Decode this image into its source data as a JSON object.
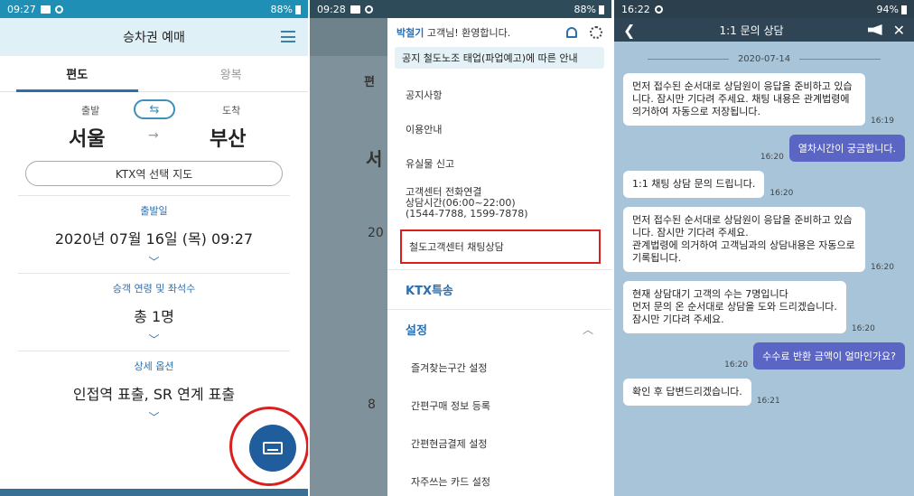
{
  "screen1": {
    "status": {
      "time": "09:27",
      "right": "88%"
    },
    "title": "승차권 예매",
    "tabs": [
      "편도",
      "왕복"
    ],
    "route": {
      "from_label": "출발",
      "to_label": "도착",
      "from_city": "서울",
      "to_city": "부산",
      "arrow": "→"
    },
    "map_button": "KTX역 선택 지도",
    "departure": {
      "label": "출발일",
      "value": "2020년 07월 16일 (목) 09:27"
    },
    "passengers": {
      "label": "승객 연령 및 좌석수",
      "value": "총 1명"
    },
    "options": {
      "label": "상세 옵션",
      "value": "인접역 표출, SR 연계 표출"
    },
    "chevron": "﹀"
  },
  "screen2": {
    "status": {
      "time": "09:28",
      "right": "88%"
    },
    "ghost": {
      "tab": "편",
      "city": "서",
      "date": "20",
      "num": "8"
    },
    "greeting_name": "박철기",
    "greeting_rest": " 고객님! 환영합니다.",
    "notice": "공지 철도노조 태업(파업예고)에 따른 안내",
    "menu": [
      "공지사항",
      "이용안내",
      "유실물 신고"
    ],
    "callcenter": [
      "고객센터 전화연결",
      "상담시간(06:00~22:00)",
      "(1544-7788, 1599-7878)"
    ],
    "chat_item": "철도고객센터 채팅상담",
    "section_ktx": "KTX특송",
    "section_settings": "설정",
    "settings_items": [
      "즐겨찾는구간 설정",
      "간편구매 정보 등록",
      "간편현금결제 설정",
      "자주쓰는 카드 설정"
    ]
  },
  "screen3": {
    "status": {
      "time": "16:22",
      "right": "94%"
    },
    "title": "1:1 문의 상담",
    "date": "2020-07-14",
    "messages": [
      {
        "dir": "in",
        "text": "먼저 접수된 순서대로 상담원이 응답을 준비하고 있습니다. 잠시만 기다려 주세요. 채팅 내용은 관계법령에 의거하여 자동으로 저장됩니다.",
        "time": "16:19"
      },
      {
        "dir": "out",
        "text": "열차시간이 궁금합니다.",
        "time": "16:20"
      },
      {
        "dir": "in",
        "text": "1:1 채팅 상담 문의 드립니다.",
        "time": "16:20"
      },
      {
        "dir": "in",
        "text": "먼저 접수된 순서대로 상담원이 응답을 준비하고 있습니다. 잠시만 기다려 주세요.\n관계법령에 의거하여 고객님과의 상담내용은 자동으로 기록됩니다.",
        "time": "16:20"
      },
      {
        "dir": "in",
        "text": "현재 상담대기 고객의 수는 7명입니다\n먼저 문의 온 순서대로 상담을 도와 드리겠습니다.\n잠시만 기다려 주세요.",
        "time": "16:20"
      },
      {
        "dir": "out",
        "text": "수수료 반환 금액이 얼마인가요?",
        "time": "16:20"
      },
      {
        "dir": "in",
        "text": "확인 후 답변드리겠습니다.",
        "time": "16:21"
      }
    ]
  },
  "colors": {
    "accent": "#2b6fb0",
    "highlight": "#d8201f",
    "out_bubble": "#5b66c4",
    "chat_bg": "#a7c4d9"
  }
}
